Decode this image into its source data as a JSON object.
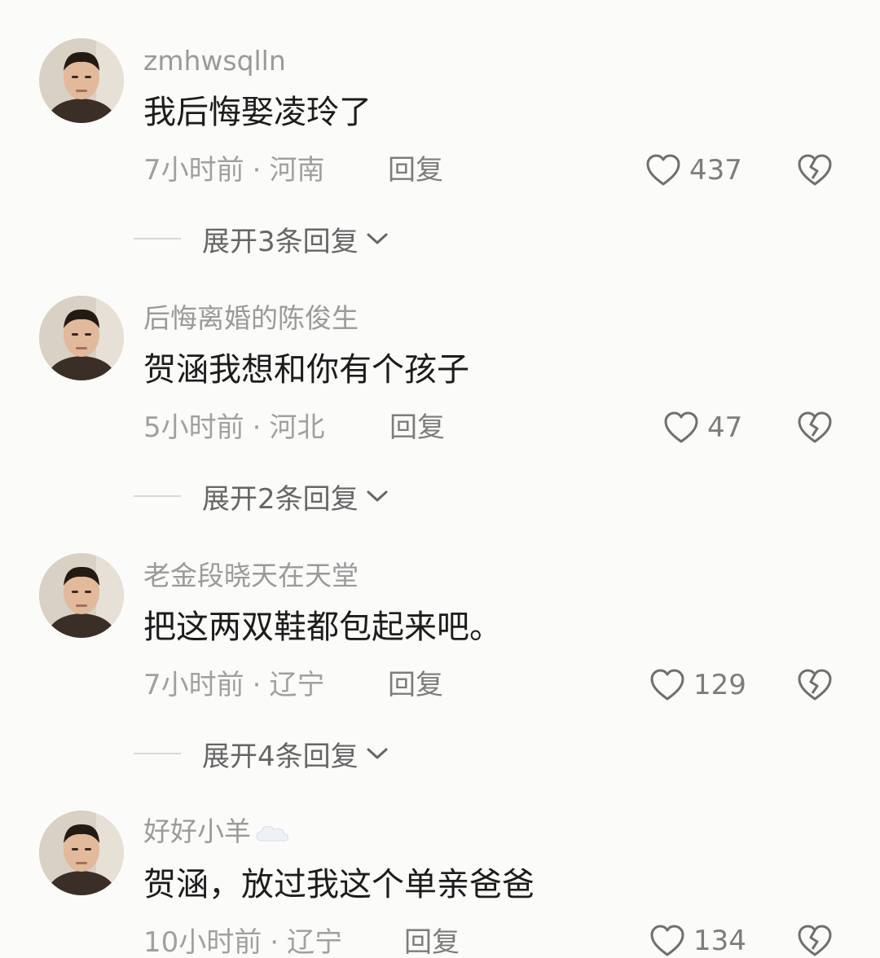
{
  "comments": [
    {
      "username": "zmhwsqlln",
      "text": "我后悔娶凌玲了",
      "time": "7小时前",
      "location": "河南",
      "separator": "·",
      "reply_label": "回复",
      "likes": "437",
      "expand_label": "展开3条回复"
    },
    {
      "username": "后悔离婚的陈俊生",
      "text": "贺涵我想和你有个孩子",
      "time": "5小时前",
      "location": "河北",
      "separator": "·",
      "reply_label": "回复",
      "likes": "47",
      "expand_label": "展开2条回复"
    },
    {
      "username": "老金段晓天在天堂",
      "text": "把这两双鞋都包起来吧。",
      "time": "7小时前",
      "location": "辽宁",
      "separator": "·",
      "reply_label": "回复",
      "likes": "129",
      "expand_label": "展开4条回复"
    },
    {
      "username": "好好小羊",
      "text": "贺涵，放过我这个单亲爸爸",
      "time": "10小时前",
      "location": "辽宁",
      "separator": "·",
      "reply_label": "回复",
      "likes": "134"
    }
  ],
  "colors": {
    "background": "#fbfbf9",
    "username": "#9a9a9a",
    "comment_text": "#1c1c1c",
    "meta": "#a0a0a0",
    "action": "#7d7d7d"
  },
  "icons": {
    "like": "heart-outline-icon",
    "dislike": "broken-heart-icon",
    "expand": "chevron-down-icon",
    "username_badge": "cloud-icon"
  }
}
